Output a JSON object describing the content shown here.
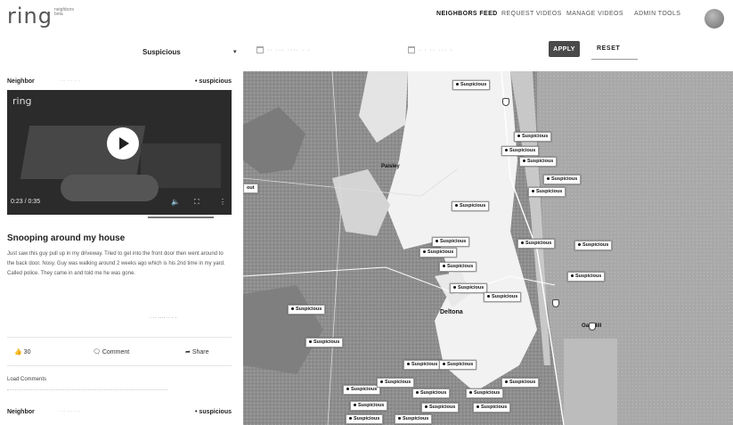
{
  "brand": {
    "logo_text": "ring",
    "logo_sub": "neighbors beta"
  },
  "nav": [
    {
      "label": "NEIGHBORS FEED",
      "active": true
    },
    {
      "label": "REQUEST VIDEOS",
      "active": false
    },
    {
      "label": "MANAGE VIDEOS",
      "active": false
    },
    {
      "label": "ADMIN TOOLS",
      "active": false
    }
  ],
  "filters": {
    "category_value": "Suspicious",
    "apply_label": "APPLY",
    "reset_label": "RESET"
  },
  "feed": {
    "post": {
      "author": "Neighbor",
      "tag": "• suspicious",
      "video_brand": "ring",
      "video_time": "0:23 / 0:35",
      "video_progress": 0.66,
      "title": "Snooping around my house",
      "body": "Just saw this guy pull up in my driveway. Tried to get into the front door then went around to the back door. Nosy. Guy was walking around 2 weeks ago which is his 2nd time in my yard. Called police. They came in and told me he was gone.",
      "likes": "30",
      "comment_label": "Comment",
      "share_label": "Share"
    },
    "load_comments": "Load Comments",
    "next_post": {
      "author": "Neighbor",
      "tag": "• suspicious"
    }
  },
  "map": {
    "places": [
      {
        "id": "deland",
        "label": "Deltona"
      },
      {
        "id": "ocala",
        "label": "Deland"
      }
    ],
    "pin_label": "Suspicious",
    "colors": {
      "land": "#8c8c8c",
      "lake": "#dcdcdc",
      "road": "#ffffff",
      "ocean": "#a9a9a9"
    }
  }
}
